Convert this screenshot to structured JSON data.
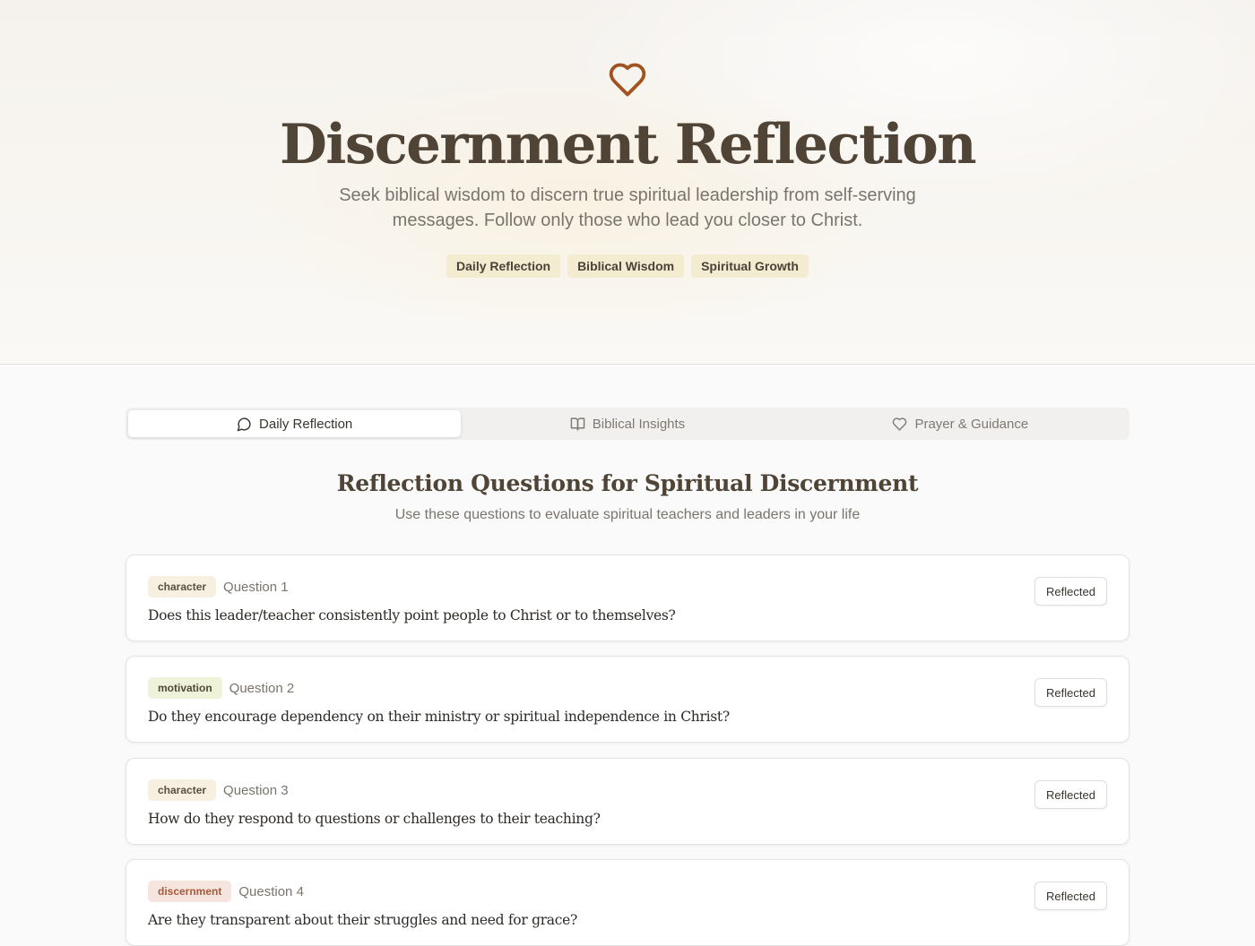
{
  "hero": {
    "icon": "heart-icon",
    "title": "Discernment Reflection",
    "subtitle": "Seek biblical wisdom to discern true spiritual leadership from self-serving messages. Follow only those who lead you closer to Christ.",
    "tags": [
      "Daily Reflection",
      "Biblical Wisdom",
      "Spiritual Growth"
    ]
  },
  "tabs": [
    {
      "label": "Daily Reflection",
      "icon": "message-circle-icon",
      "active": true
    },
    {
      "label": "Biblical Insights",
      "icon": "book-open-icon",
      "active": false
    },
    {
      "label": "Prayer & Guidance",
      "icon": "heart-icon",
      "active": false
    }
  ],
  "section": {
    "title": "Reflection Questions for Spiritual Discernment",
    "subtitle": "Use these questions to evaluate spiritual teachers and leaders in your life"
  },
  "questions": [
    {
      "category": "character",
      "number": "Question 1",
      "text": "Does this leader/teacher consistently point people to Christ or to themselves?",
      "button": "Reflected"
    },
    {
      "category": "motivation",
      "number": "Question 2",
      "text": "Do they encourage dependency on their ministry or spiritual independence in Christ?",
      "button": "Reflected"
    },
    {
      "category": "character",
      "number": "Question 3",
      "text": "How do they respond to questions or challenges to their teaching?",
      "button": "Reflected"
    },
    {
      "category": "discernment",
      "number": "Question 4",
      "text": "Are they transparent about their struggles and need for grace?",
      "button": "Reflected"
    }
  ],
  "colors": {
    "accent": "#a0531f",
    "title": "#4f4436",
    "tag_bg": "#f3ecd0"
  }
}
